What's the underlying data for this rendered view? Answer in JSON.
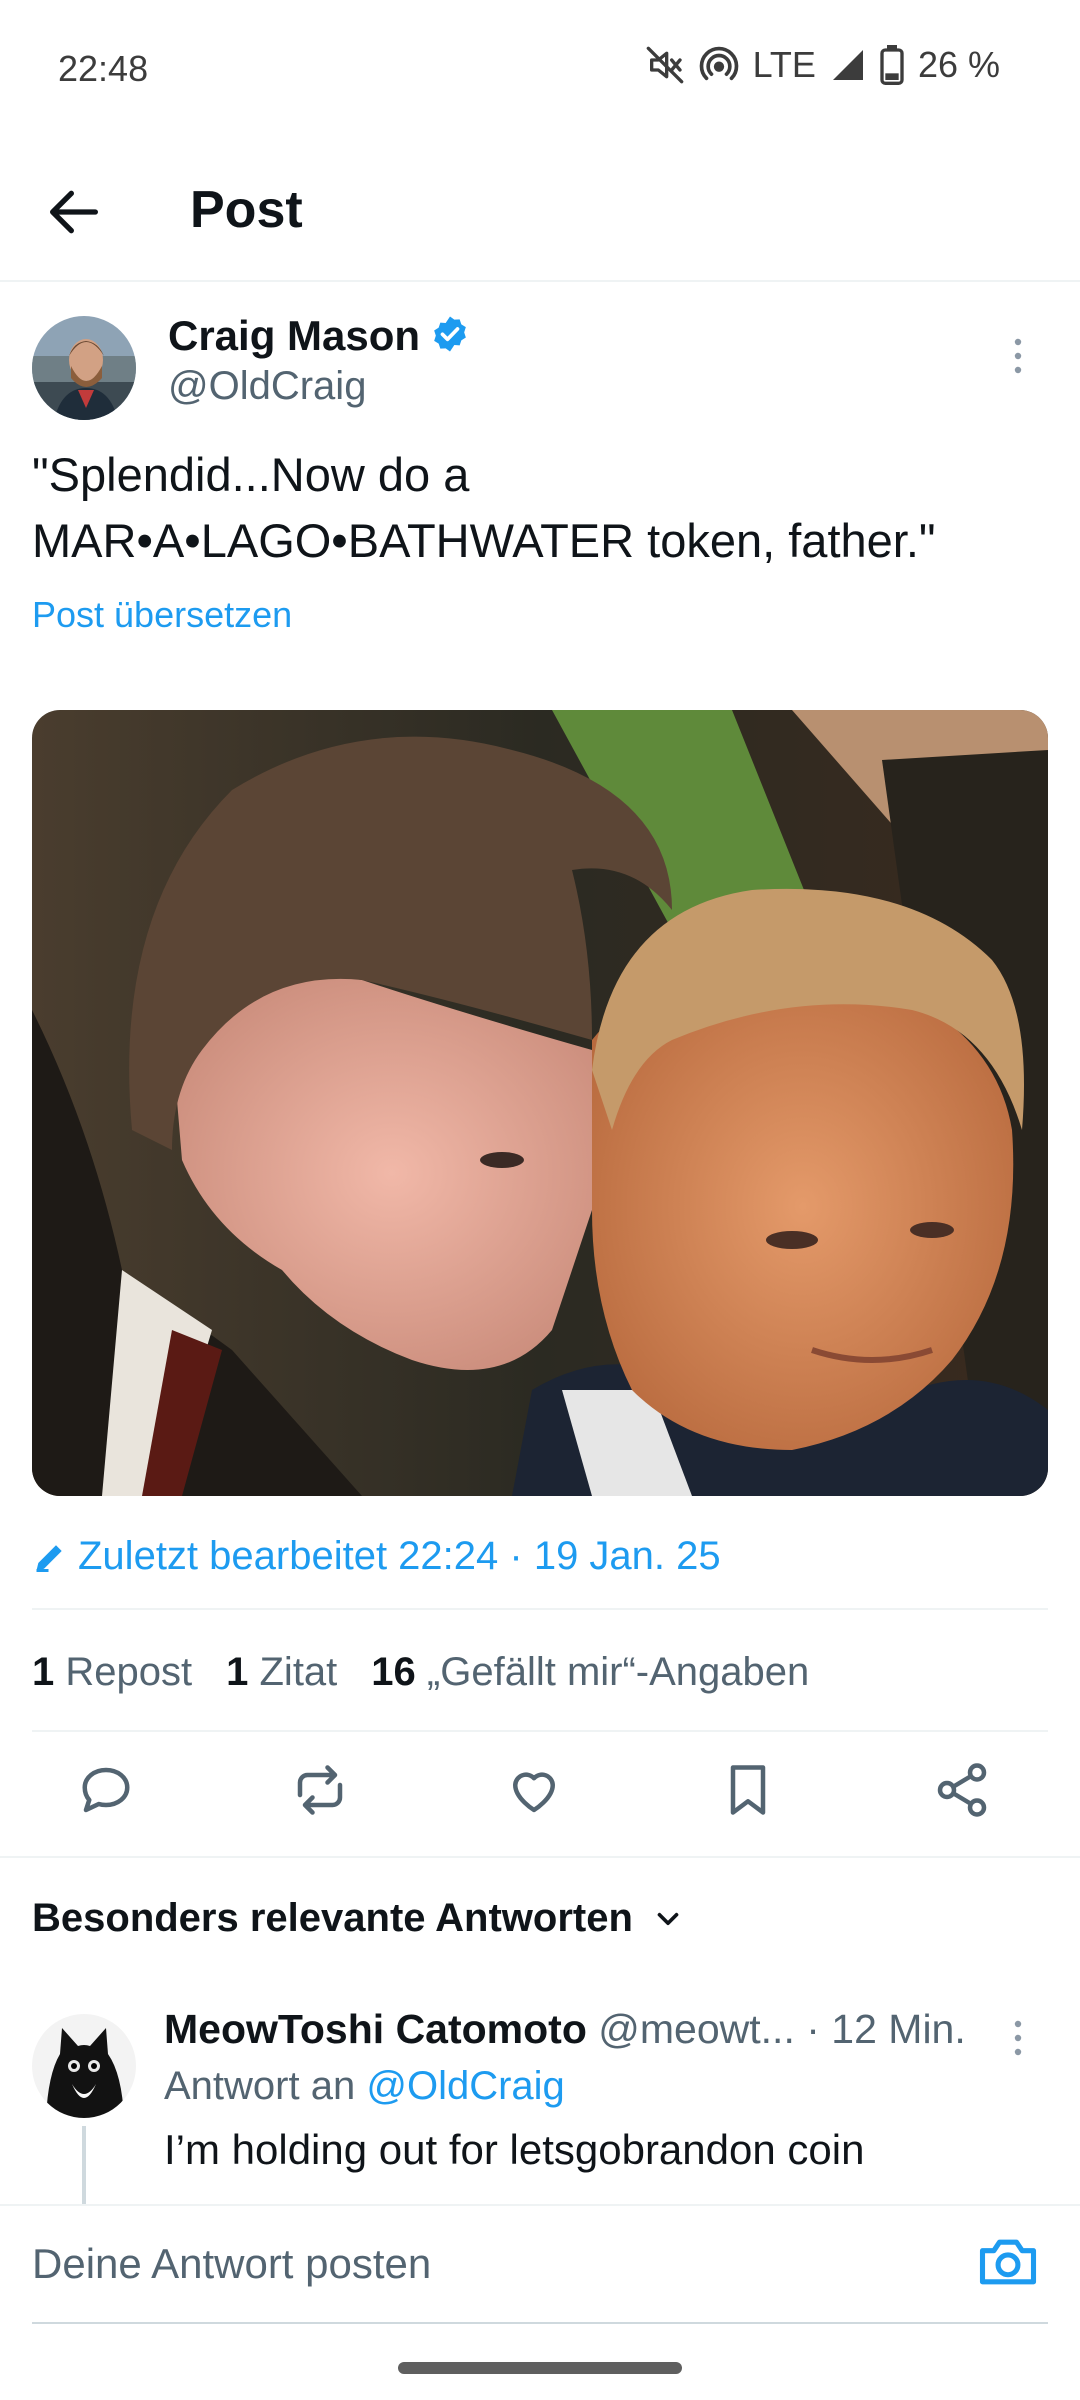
{
  "status_bar": {
    "time": "22:48",
    "network": "LTE",
    "battery": "26 %",
    "icons": [
      "mute-icon",
      "hotspot-icon",
      "signal-icon",
      "battery-icon"
    ]
  },
  "header": {
    "title": "Post",
    "back_icon": "arrow-left-icon"
  },
  "post": {
    "author_name": "Craig Mason",
    "author_handle": "@OldCraig",
    "verified": true,
    "text": "\"Splendid...Now do a\nMAR•A•LAGO•BATHWATER token, father.\"",
    "translate_label": "Post übersetzen",
    "edited_label": "Zuletzt bearbeitet 22:24 · 19 Jan. 25",
    "stats": {
      "reposts_count": "1",
      "reposts_label": "Repost",
      "quotes_count": "1",
      "quotes_label": "Zitat",
      "likes_count": "16",
      "likes_label": "„Gefällt mir“-Angaben"
    },
    "actions": [
      "reply-icon",
      "repost-icon",
      "like-icon",
      "bookmark-icon",
      "share-icon"
    ]
  },
  "replies": {
    "sort_label": "Besonders relevante Antworten",
    "items": [
      {
        "name": "MeowToshi Catomoto",
        "handle": "@meowt...",
        "time": "· 12 Min.",
        "reply_to_prefix": "Antwort an",
        "reply_to_handle": "@OldCraig",
        "text": "I’m holding out for letsgobrandon coin"
      }
    ]
  },
  "composer": {
    "placeholder": "Deine Antwort posten"
  },
  "colors": {
    "accent": "#1d9bf0",
    "text": "#0f1419",
    "muted": "#536471",
    "divider": "#eff3f4"
  }
}
